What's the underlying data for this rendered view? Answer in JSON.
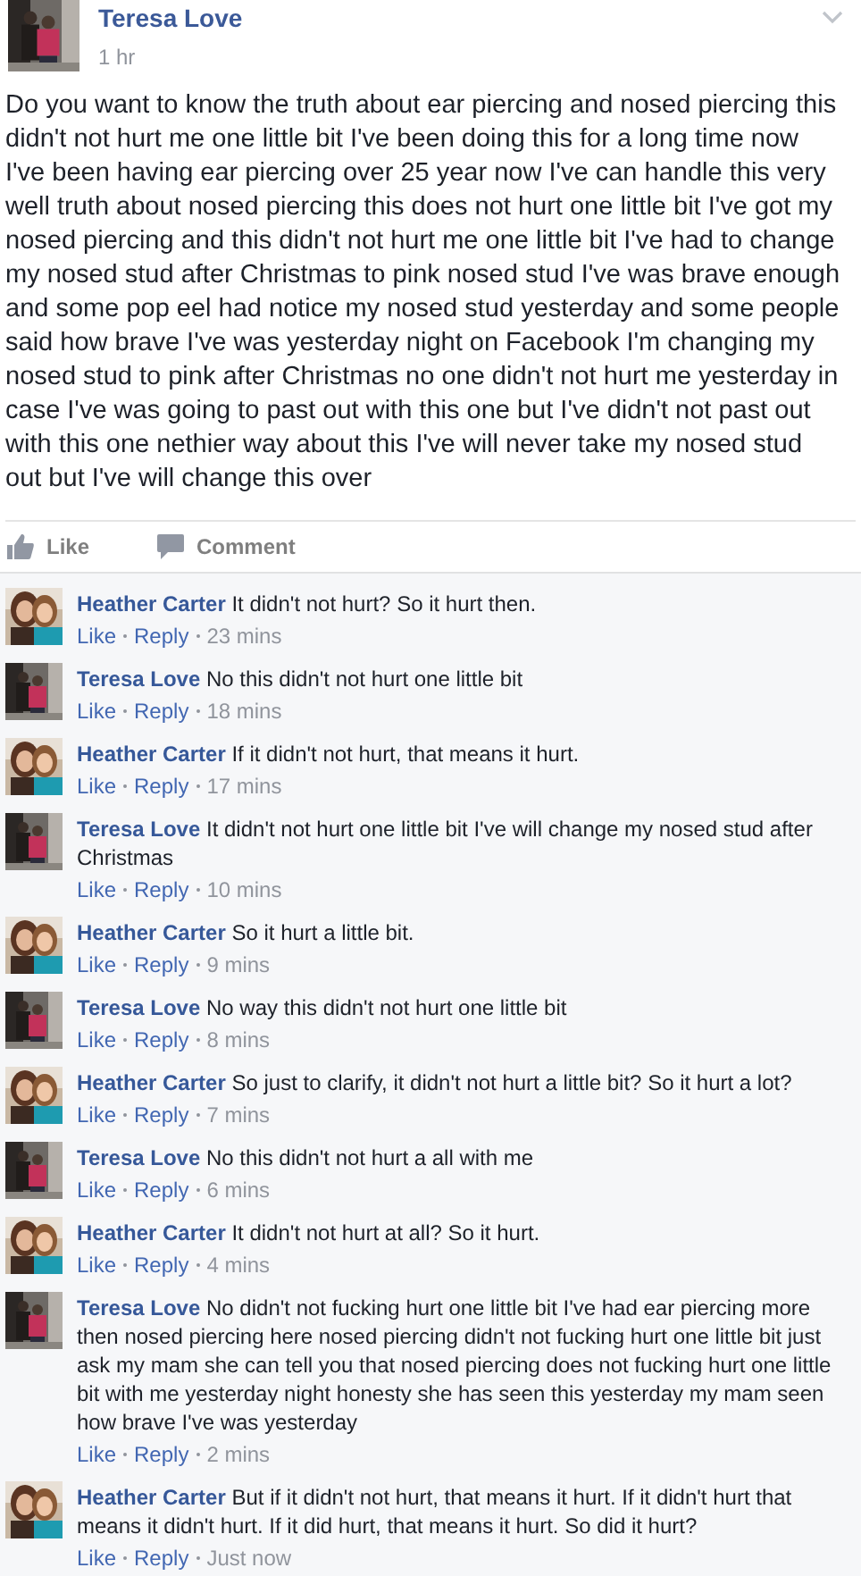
{
  "post": {
    "author": "Teresa Love",
    "time": "1 hr",
    "text": "Do you want to know the truth about ear piercing and nosed piercing this didn't not hurt me one little bit I've been doing this for a long time now I've been having ear piercing over 25 year now I've can handle this very well truth about nosed piercing this does not hurt one little bit I've got my nosed piercing and this didn't not hurt me one little bit I've had to change my nosed stud after Christmas to pink nosed stud I've was brave enough and some pop eel had notice my nosed stud yesterday and some people said how brave I've was yesterday night on Facebook I'm changing my nosed stud to pink after Christmas no one didn't not hurt me yesterday in case I've was going to past out with this one but I've didn't not past out with this one nethier way about this I've will never take my nosed stud out but I've will change this over"
  },
  "actions": [
    "Like",
    "Comment"
  ],
  "comments": [
    {
      "author": "Heather Carter",
      "text": "It didn't not hurt? So it hurt then.",
      "like": "Like",
      "reply": "Reply",
      "time": "23 mins"
    },
    {
      "author": "Teresa Love",
      "text": "No this didn't not hurt one little bit",
      "like": "Like",
      "reply": "Reply",
      "time": "18 mins"
    },
    {
      "author": "Heather Carter",
      "text": "If it didn't not hurt, that means it hurt.",
      "like": "Like",
      "reply": "Reply",
      "time": "17 mins"
    },
    {
      "author": "Teresa Love",
      "text": "It didn't not hurt one little bit I've will change my nosed stud after Christmas",
      "like": "Like",
      "reply": "Reply",
      "time": "10 mins"
    },
    {
      "author": "Heather Carter",
      "text": "So it hurt a little bit.",
      "like": "Like",
      "reply": "Reply",
      "time": "9 mins"
    },
    {
      "author": "Teresa Love",
      "text": "No way this didn't not hurt one little bit",
      "like": "Like",
      "reply": "Reply",
      "time": "8 mins"
    },
    {
      "author": "Heather Carter",
      "text": "So just to clarify, it didn't not hurt a little bit? So it hurt a lot?",
      "like": "Like",
      "reply": "Reply",
      "time": "7 mins"
    },
    {
      "author": "Teresa Love",
      "text": "No this didn't not hurt a all with me",
      "like": "Like",
      "reply": "Reply",
      "time": "6 mins"
    },
    {
      "author": "Heather Carter",
      "text": "It didn't not hurt at all? So it hurt.",
      "like": "Like",
      "reply": "Reply",
      "time": "4 mins"
    },
    {
      "author": "Teresa Love",
      "text": "No didn't not fucking hurt one little bit I've had ear piercing more then nosed piercing here nosed piercing didn't not fucking hurt one little bit just ask my mam she can tell you that nosed piercing does not fucking hurt one little bit with me yesterday night honesty she has seen this yesterday my mam seen how brave I've was yesterday",
      "like": "Like",
      "reply": "Reply",
      "time": "2 mins"
    },
    {
      "author": "Heather Carter",
      "text": "But if it didn't not hurt, that means it hurt. If it didn't hurt that means it didn't hurt. If it did hurt, that means it hurt. So did it hurt?",
      "like": "Like",
      "reply": "Reply",
      "time": "Just now"
    }
  ]
}
